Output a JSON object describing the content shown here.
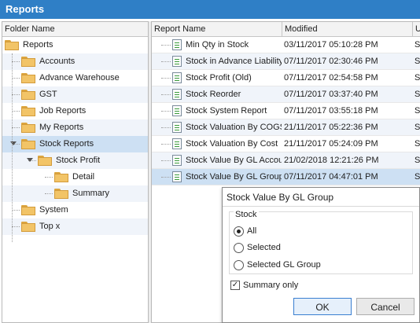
{
  "window": {
    "title": "Reports"
  },
  "folder_pane": {
    "header": "Folder Name",
    "items": [
      {
        "label": "Reports",
        "icon": "folder-icon",
        "expander": ""
      },
      {
        "label": "Accounts",
        "icon": "folder-icon",
        "expander": ""
      },
      {
        "label": "Advance Warehouse",
        "icon": "folder-icon",
        "expander": ""
      },
      {
        "label": "GST",
        "icon": "folder-icon",
        "expander": ""
      },
      {
        "label": "Job Reports",
        "icon": "folder-icon",
        "expander": ""
      },
      {
        "label": "My Reports",
        "icon": "folder-icon",
        "expander": ""
      },
      {
        "label": "Stock Reports",
        "icon": "folder-icon",
        "expander": "expanded-chevron-icon",
        "selected": true
      },
      {
        "label": "Stock Profit",
        "icon": "folder-icon",
        "expander": "expanded-chevron-icon"
      },
      {
        "label": "Detail",
        "icon": "folder-icon",
        "expander": ""
      },
      {
        "label": "Summary",
        "icon": "folder-icon",
        "expander": ""
      },
      {
        "label": "System",
        "icon": "folder-icon",
        "expander": ""
      },
      {
        "label": "Top x",
        "icon": "folder-icon",
        "expander": ""
      }
    ]
  },
  "report_grid": {
    "columns": [
      "Report Name",
      "Modified",
      "U"
    ],
    "rows": [
      {
        "name": "Min Qty in Stock",
        "modified": "03/11/2017 05:10:28 PM",
        "u": "S"
      },
      {
        "name": "Stock in Advance Liability",
        "modified": "07/11/2017 02:30:46 PM",
        "u": "S"
      },
      {
        "name": "Stock Profit (Old)",
        "modified": "07/11/2017 02:54:58 PM",
        "u": "S"
      },
      {
        "name": "Stock Reorder",
        "modified": "07/11/2017 03:37:40 PM",
        "u": "S"
      },
      {
        "name": "Stock System Report",
        "modified": "07/11/2017 03:55:18 PM",
        "u": "S"
      },
      {
        "name": "Stock Valuation By COGS",
        "modified": "21/11/2017 05:22:36 PM",
        "u": "S"
      },
      {
        "name": "Stock Valuation By Cost",
        "modified": "21/11/2017 05:24:09 PM",
        "u": "S"
      },
      {
        "name": "Stock Value By GL Accour",
        "modified": "21/02/2018 12:21:26 PM",
        "u": "S"
      },
      {
        "name": "Stock Value By GL Group",
        "modified": "07/11/2017 04:47:01 PM",
        "u": "S",
        "selected": true
      }
    ]
  },
  "popup": {
    "title": "Stock Value By GL Group",
    "group_label": "Stock",
    "options": [
      {
        "label": "All",
        "checked": true
      },
      {
        "label": "Selected",
        "checked": false
      },
      {
        "label": "Selected GL Group",
        "checked": false
      }
    ],
    "summary_only": {
      "label": "Summary only",
      "checked": true,
      "mark": "✓"
    },
    "ok_label": "OK",
    "cancel_label": "Cancel"
  },
  "colors": {
    "titlebar": "#2f7fc6",
    "selection": "#cde0f3",
    "folder": "#f2c467",
    "alt_row": "#f0f4fa"
  }
}
